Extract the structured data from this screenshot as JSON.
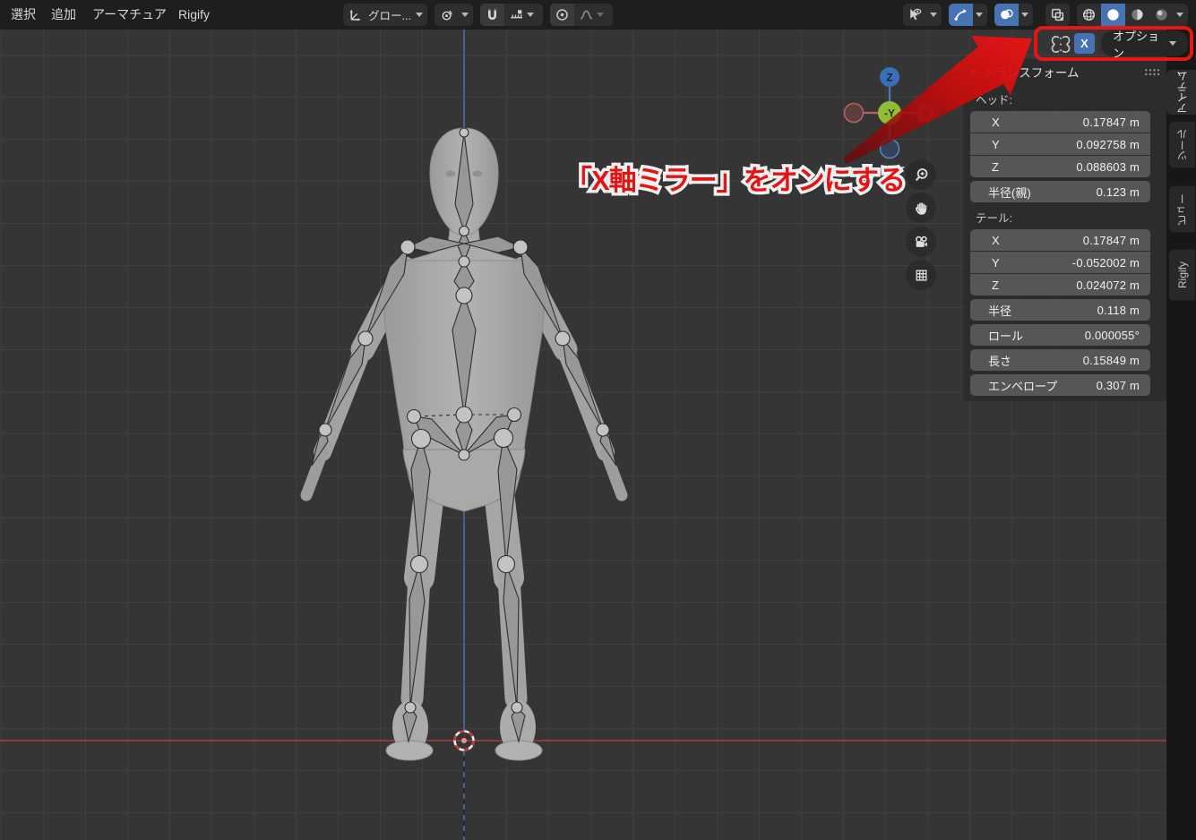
{
  "topbar": {
    "menus": [
      {
        "label": "選択"
      },
      {
        "label": "追加"
      },
      {
        "label": "アーマチュア"
      },
      {
        "label": "Rigify"
      }
    ],
    "orientation_label": "グロー..."
  },
  "tool_settings": {
    "mirror_x_label": "X",
    "options_label": "オプション"
  },
  "annotation": {
    "text": "「X軸ミラー」をオンにする"
  },
  "gizmo": {
    "z_label": "Z",
    "y_label": "-Y",
    "x_label": "X"
  },
  "sidebar": {
    "panel_title": "トランスフォーム",
    "tabs": [
      {
        "label": "アイテム"
      },
      {
        "label": "ツール"
      },
      {
        "label": "ビュー"
      },
      {
        "label": "Rigify"
      }
    ],
    "head_section": {
      "label": "ヘッド:",
      "rows": [
        {
          "label": "X",
          "value": "0.17847 m"
        },
        {
          "label": "Y",
          "value": "0.092758 m"
        },
        {
          "label": "Z",
          "value": "0.088603 m"
        }
      ],
      "radius_row": {
        "label": "半径(親)",
        "value": "0.123 m"
      }
    },
    "tail_section": {
      "label": "テール:",
      "rows": [
        {
          "label": "X",
          "value": "0.17847 m"
        },
        {
          "label": "Y",
          "value": "-0.052002 m"
        },
        {
          "label": "Z",
          "value": "0.024072 m"
        }
      ]
    },
    "single_rows": [
      {
        "label": "半径",
        "value": "0.118 m"
      },
      {
        "label": "ロール",
        "value": "0.000055°"
      },
      {
        "label": "長さ",
        "value": "0.15849 m"
      },
      {
        "label": "エンベロープ",
        "value": "0.307 m"
      }
    ]
  },
  "colors": {
    "accent_blue": "#4772b3",
    "highlight_red": "#e51616",
    "axis_red": "#a04040",
    "axis_blue": "#4c70a8"
  }
}
